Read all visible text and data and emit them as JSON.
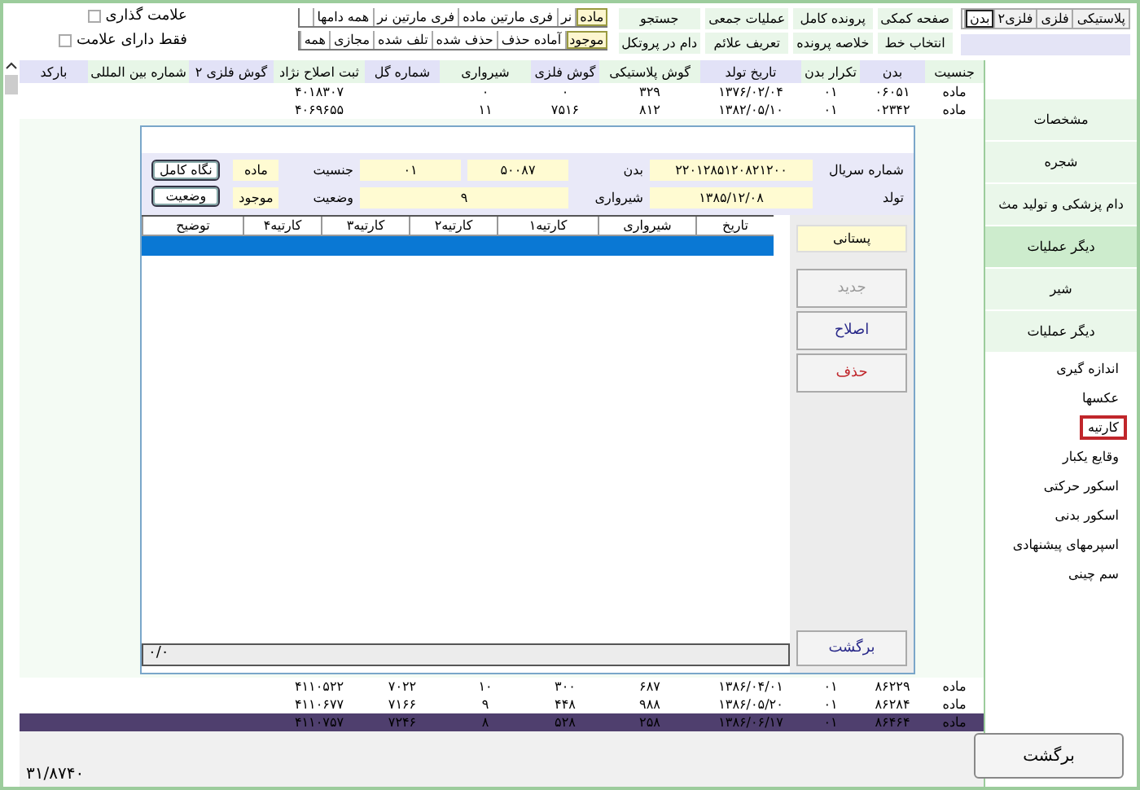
{
  "view_tabs": [
    {
      "label": "پلاستیکی",
      "selected": false
    },
    {
      "label": "فلزی",
      "selected": false
    },
    {
      "label": "فلزی۲",
      "selected": false
    },
    {
      "label": "بدن",
      "selected": true
    }
  ],
  "menu": [
    [
      "صفحه کمکی",
      "پرونده کامل",
      "عملیات جمعی",
      "جستجو"
    ],
    [
      "انتخاب خط",
      "خلاصه پرونده",
      "تعریف علائم",
      "دام در پروتکل"
    ]
  ],
  "sex_filter": [
    {
      "label": "ماده",
      "selected": true
    },
    {
      "label": "نر",
      "selected": false
    },
    {
      "label": "فری مارتین ماده",
      "selected": false
    },
    {
      "label": "فری مارتین نر",
      "selected": false
    },
    {
      "label": "همه دامها",
      "selected": false
    }
  ],
  "status_filter": [
    {
      "label": "موجود",
      "selected": true
    },
    {
      "label": "آماده حذف",
      "selected": false
    },
    {
      "label": "حذف شده",
      "selected": false
    },
    {
      "label": "تلف شده",
      "selected": false
    },
    {
      "label": "مجازی",
      "selected": false
    },
    {
      "label": "همه",
      "selected": false
    }
  ],
  "checkboxes": [
    {
      "label": "علامت گذاری",
      "checked": false
    },
    {
      "label": "فقط دارای علامت",
      "checked": false
    }
  ],
  "table": {
    "columns": [
      "جنسیت",
      "بدن",
      "تکرار بدن",
      "تاریخ تولد",
      "گوش پلاستیکی",
      "گوش فلزی",
      "شیرواری",
      "شماره گل",
      "ثبت اصلاح نژاد",
      "گوش فلزی ۲",
      "شماره بین المللی",
      "بارکد"
    ],
    "rows_top": [
      {
        "selected": false,
        "cells": [
          "ماده",
          "۰۶۰۵۱",
          "۰۱",
          "۱۳۷۶/۰۲/۰۴",
          "۳۲۹",
          "۰",
          "۰",
          null,
          "۴۰۱۸۳۰۷",
          null,
          null,
          null
        ]
      },
      {
        "selected": false,
        "cells": [
          "ماده",
          "۰۲۳۴۲",
          "۰۱",
          "۱۳۸۲/۰۵/۱۰",
          "۸۱۲",
          "۷۵۱۶",
          "۱۱",
          null,
          "۴۰۶۹۶۵۵",
          null,
          null,
          null
        ]
      }
    ],
    "rows_bottom": [
      {
        "selected": false,
        "cells": [
          "ماده",
          "۸۶۲۲۹",
          "۰۱",
          "۱۳۸۶/۰۴/۰۱",
          "۶۸۷",
          "۳۰۰",
          "۱۰",
          "۷۰۲۲",
          "۴۱۱۰۵۲۲",
          null,
          null,
          null
        ]
      },
      {
        "selected": false,
        "cells": [
          "ماده",
          "۸۶۲۸۴",
          "۰۱",
          "۱۳۸۶/۰۵/۲۰",
          "۹۸۸",
          "۴۴۸",
          "۹",
          "۷۱۶۶",
          "۴۱۱۰۶۷۷",
          null,
          null,
          null
        ]
      },
      {
        "selected": true,
        "cells": [
          "ماده",
          "۸۶۴۶۴",
          "۰۱",
          "۱۳۸۶/۰۶/۱۷",
          "۲۵۸",
          "۵۲۸",
          "۸",
          "۷۲۴۶",
          "۴۱۱۰۷۵۷",
          null,
          null,
          null
        ]
      }
    ]
  },
  "count": "۳۱/۸۷۴۰",
  "nav": [
    {
      "kind": "section",
      "label": "مشخصات",
      "selected": false
    },
    {
      "kind": "section",
      "label": "شجره",
      "selected": false
    },
    {
      "kind": "section",
      "label": "دام پزشکی و تولید مث",
      "selected": false
    },
    {
      "kind": "section",
      "label": "دیگر عملیات",
      "selected": true
    },
    {
      "kind": "section",
      "label": "شیر",
      "selected": false
    },
    {
      "kind": "section",
      "label": "دیگر عملیات",
      "selected": false
    },
    {
      "kind": "item",
      "label": "اندازه گیری",
      "selected": false
    },
    {
      "kind": "item",
      "label": "عکسها",
      "selected": false
    },
    {
      "kind": "item",
      "label": "کارتیه",
      "selected": true
    },
    {
      "kind": "item",
      "label": "وقایع یکبار",
      "selected": false
    },
    {
      "kind": "item",
      "label": "اسکور حرکتی",
      "selected": false
    },
    {
      "kind": "item",
      "label": "اسکور بدنی",
      "selected": false
    },
    {
      "kind": "item",
      "label": "اسپرمهای پیشنهادی",
      "selected": false
    },
    {
      "kind": "item",
      "label": "سم چینی",
      "selected": false
    }
  ],
  "back_button": "برگشت",
  "dialog": {
    "fields": [
      [
        {
          "label": "شماره سریال",
          "values": [
            "۲۲۰۱۲۸۵۱۲۰۸۲۱۲۰۰"
          ]
        },
        {
          "label": "بدن",
          "values": [
            "۵۰۰۸۷",
            "۰۱"
          ]
        },
        {
          "label": "جنسیت",
          "values": [
            "ماده"
          ]
        }
      ],
      [
        {
          "label": "تولد",
          "values": [
            "۱۳۸۵/۱۲/۰۸"
          ]
        },
        {
          "label": "شیرواری",
          "values": [
            "۹"
          ]
        },
        {
          "label": "وضعیت",
          "values": [
            "موجود"
          ]
        }
      ]
    ],
    "buttons": [
      "نگاه کامل",
      "وضعیت"
    ],
    "tab": {
      "label": "پستانی",
      "selected": true
    },
    "actions": [
      {
        "kind": "new",
        "label": "جدید",
        "disabled": true
      },
      {
        "kind": "edit",
        "label": "اصلاح",
        "disabled": false
      },
      {
        "kind": "delete",
        "label": "حذف",
        "disabled": false
      }
    ],
    "columns": [
      "تاریخ",
      "شیرواری",
      "کارتیه۱",
      "کارتیه۲",
      "کارتیه۳",
      "کارتیه۴",
      "توضیح"
    ],
    "rows": [
      {
        "selected": true
      }
    ],
    "status": "۰/۰",
    "back_button": "برگشت"
  }
}
